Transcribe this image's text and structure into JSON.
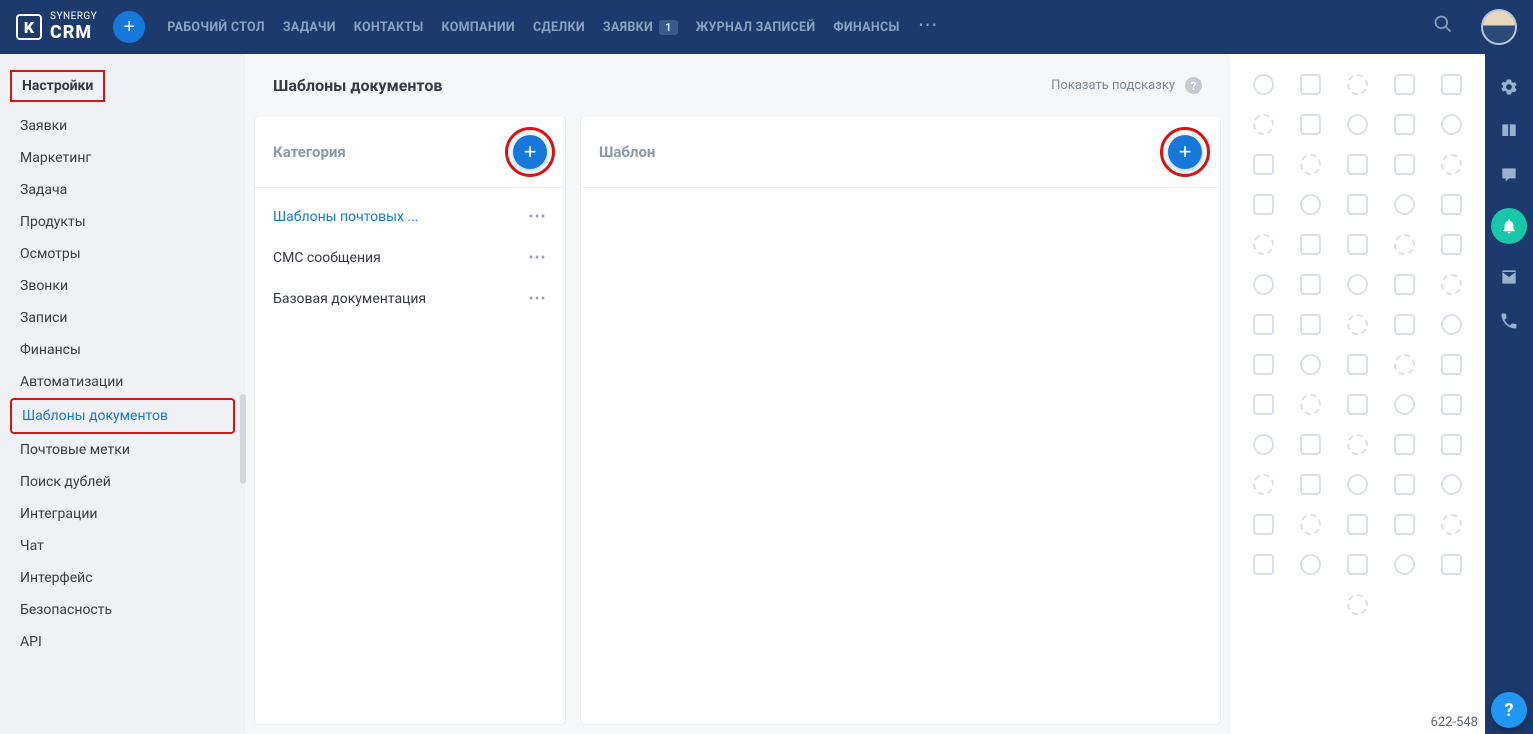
{
  "logo": {
    "top": "SYNERGY",
    "bottom": "CRM"
  },
  "top_nav": [
    {
      "label": "РАБОЧИЙ СТОЛ"
    },
    {
      "label": "ЗАДАЧИ"
    },
    {
      "label": "КОНТАКТЫ"
    },
    {
      "label": "КОМПАНИИ"
    },
    {
      "label": "СДЕЛКИ"
    },
    {
      "label": "ЗАЯВКИ",
      "badge": "1"
    },
    {
      "label": "ЖУРНАЛ ЗАПИСЕЙ"
    },
    {
      "label": "ФИНАНСЫ"
    }
  ],
  "sidebar": {
    "title": "Настройки",
    "items": [
      {
        "label": "Заявки"
      },
      {
        "label": "Маркетинг"
      },
      {
        "label": "Задача"
      },
      {
        "label": "Продукты"
      },
      {
        "label": "Осмотры"
      },
      {
        "label": "Звонки"
      },
      {
        "label": "Записи"
      },
      {
        "label": "Финансы"
      },
      {
        "label": "Автоматизации"
      },
      {
        "label": "Шаблоны документов",
        "active": true
      },
      {
        "label": "Почтовые метки"
      },
      {
        "label": "Поиск дублей"
      },
      {
        "label": "Интеграции"
      },
      {
        "label": "Чат"
      },
      {
        "label": "Интерфейс"
      },
      {
        "label": "Безопасность"
      },
      {
        "label": "API"
      }
    ]
  },
  "page": {
    "title": "Шаблоны документов",
    "hint": "Показать подсказку"
  },
  "category_panel": {
    "title": "Категория",
    "items": [
      {
        "label": "Шаблоны почтовых ...",
        "selected": true
      },
      {
        "label": "СМС сообщения"
      },
      {
        "label": "Базовая документация"
      }
    ]
  },
  "template_panel": {
    "title": "Шаблон"
  },
  "status": "622-548"
}
